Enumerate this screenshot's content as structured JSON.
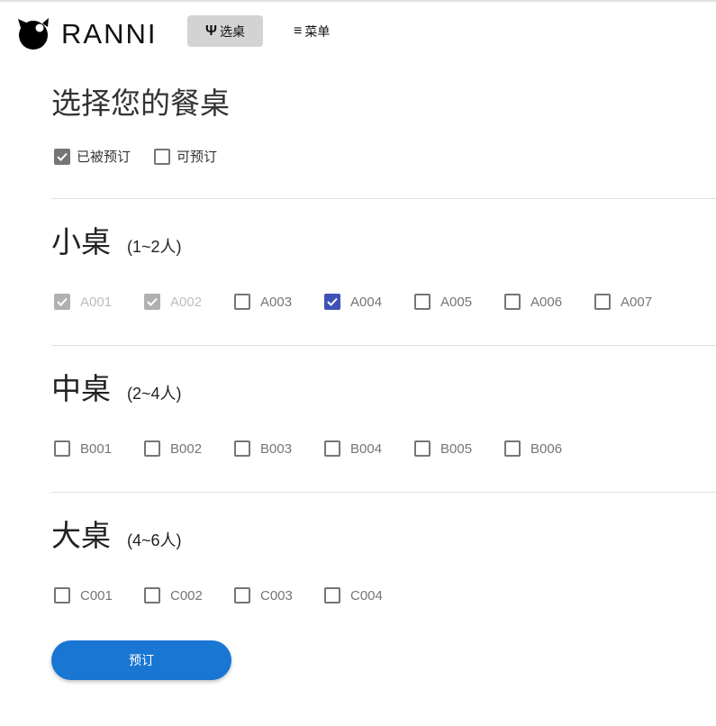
{
  "header": {
    "brand": "RANNI",
    "nav": [
      {
        "label": "选桌",
        "icon": "utensils-icon",
        "active": true
      },
      {
        "label": "菜单",
        "icon": "menu-icon",
        "active": false
      }
    ]
  },
  "title": "选择您的餐桌",
  "legend": [
    {
      "label": "已被预订",
      "checked": true
    },
    {
      "label": "可预订",
      "checked": false
    }
  ],
  "sections": [
    {
      "name": "小桌",
      "capacity": "(1~2人)",
      "tables": [
        {
          "id": "A001",
          "state": "booked"
        },
        {
          "id": "A002",
          "state": "booked"
        },
        {
          "id": "A003",
          "state": "free"
        },
        {
          "id": "A004",
          "state": "selected"
        },
        {
          "id": "A005",
          "state": "free"
        },
        {
          "id": "A006",
          "state": "free"
        },
        {
          "id": "A007",
          "state": "free"
        }
      ]
    },
    {
      "name": "中桌",
      "capacity": "(2~4人)",
      "tables": [
        {
          "id": "B001",
          "state": "free"
        },
        {
          "id": "B002",
          "state": "free"
        },
        {
          "id": "B003",
          "state": "free"
        },
        {
          "id": "B004",
          "state": "free"
        },
        {
          "id": "B005",
          "state": "free"
        },
        {
          "id": "B006",
          "state": "free"
        }
      ]
    },
    {
      "name": "大桌",
      "capacity": "(4~6人)",
      "tables": [
        {
          "id": "C001",
          "state": "free"
        },
        {
          "id": "C002",
          "state": "free"
        },
        {
          "id": "C003",
          "state": "free"
        },
        {
          "id": "C004",
          "state": "free"
        }
      ]
    }
  ],
  "submit_label": "预订",
  "colors": {
    "accent": "#1976d2",
    "selected": "#3f51b5",
    "booked": "#b0b0b0"
  }
}
